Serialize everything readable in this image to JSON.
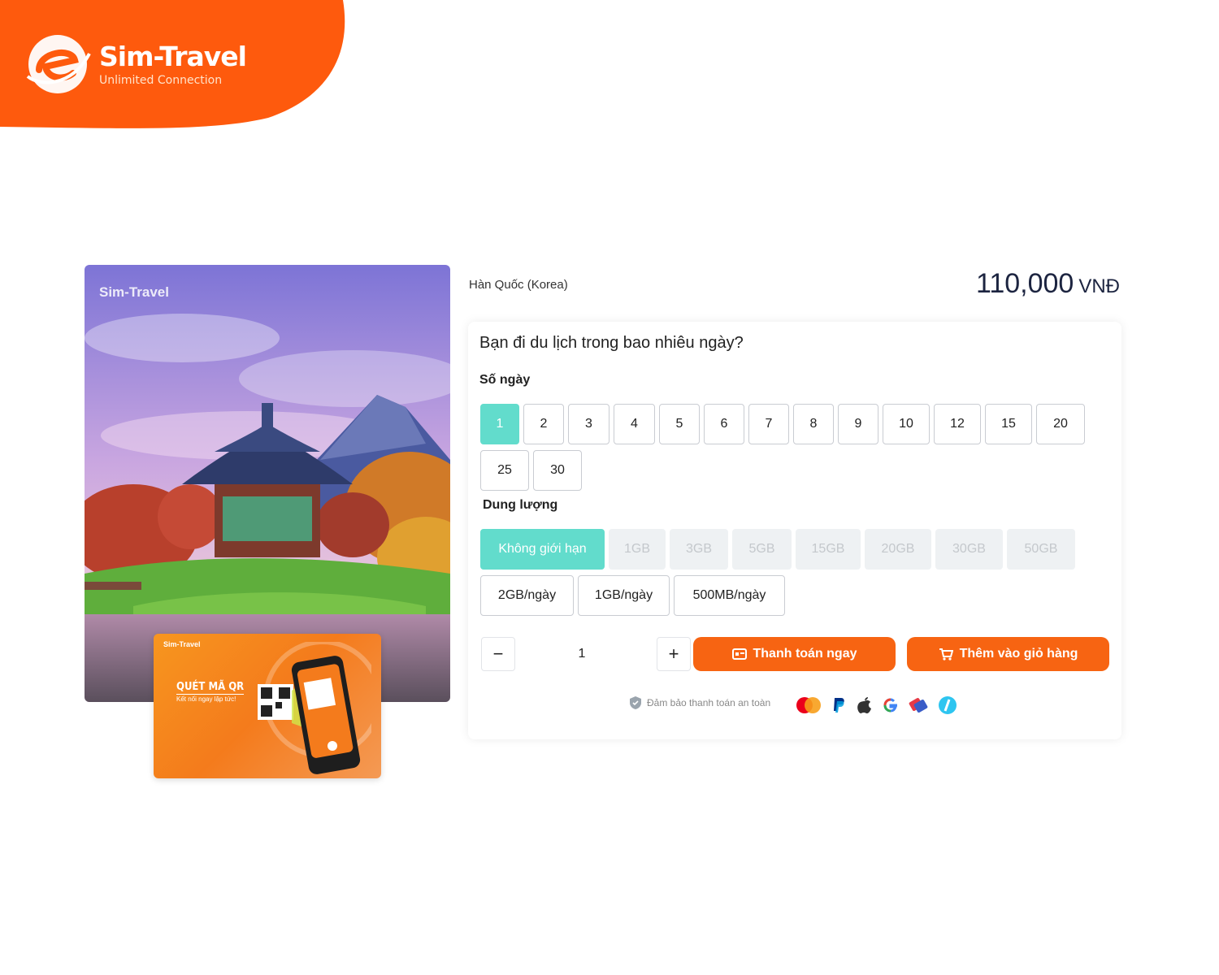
{
  "brand": {
    "name": "Sim-Travel",
    "tagline": "Unlimited Connection",
    "color": "#fe5a0d"
  },
  "hero": {
    "logo_name": "Sim-Travel",
    "logo_tagline": "Unlimited Connection",
    "qr_card": {
      "logo": "Sim-Travel",
      "title": "QUÉT MÃ QR",
      "subtitle": "Kết nối ngay lập tức!"
    }
  },
  "product": {
    "country": "Hàn Quốc (Korea)",
    "price": "110,000",
    "currency": "VNĐ"
  },
  "form": {
    "question": "Bạn đi du lịch trong bao nhiêu ngày?",
    "days_label": "Số ngày",
    "days": [
      "1",
      "2",
      "3",
      "4",
      "5",
      "6",
      "7",
      "8",
      "9",
      "10",
      "12",
      "15",
      "20",
      "25",
      "30"
    ],
    "selected_day": "1",
    "data_label": "Dung lượng",
    "data_options": [
      "Không giới hạn",
      "1GB",
      "3GB",
      "5GB",
      "15GB",
      "20GB",
      "30GB",
      "50GB"
    ],
    "selected_data": "Không giới hạn",
    "daily_options": [
      "2GB/ngày",
      "1GB/ngày",
      "500MB/ngày"
    ],
    "quantity": "1",
    "minus": "−",
    "plus": "+",
    "pay_now": "Thanh toán ngay",
    "add_cart": "Thêm vào giỏ hàng",
    "secure_text": "Đảm bảo thanh toán an toàn"
  },
  "colors": {
    "accent_teal": "#62dccc",
    "button_orange": "#f76412",
    "disabled_bg": "#eef1f3"
  },
  "payment_icons": [
    "mastercard-icon",
    "paypal-icon",
    "apple-icon",
    "google-icon",
    "card-icon",
    "stripe-icon"
  ]
}
